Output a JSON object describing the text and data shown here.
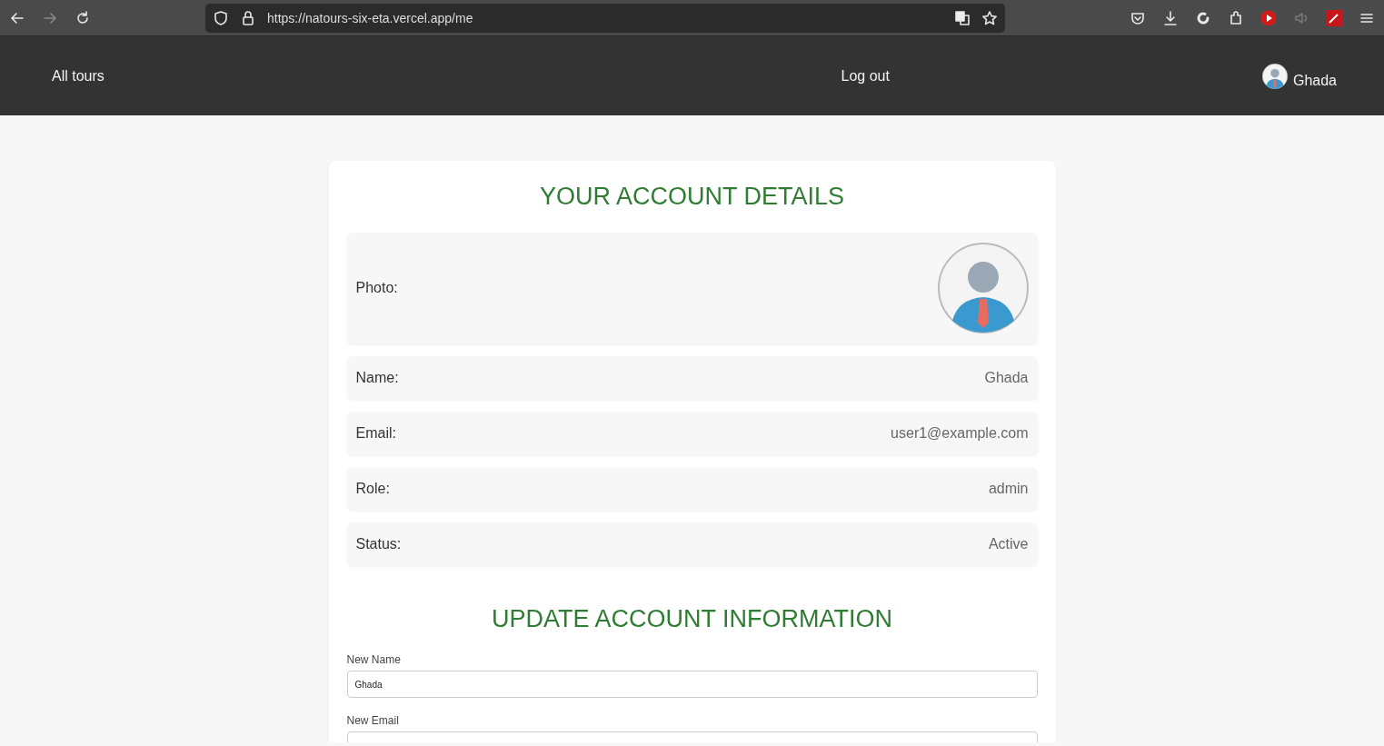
{
  "browser": {
    "url": "https://natours-six-eta.vercel.app/me",
    "forward_disabled": true
  },
  "nav": {
    "links": [
      "All tours",
      "Log out"
    ],
    "user": "Ghada"
  },
  "account": {
    "title": "YOUR ACCOUNT DETAILS",
    "details": [
      {
        "kind": "photo",
        "label": "Photo:"
      },
      {
        "kind": "text",
        "label": "Name:",
        "value": "Ghada"
      },
      {
        "kind": "text",
        "label": "Email:",
        "value": "user1@example.com"
      },
      {
        "kind": "text",
        "label": "Role:",
        "value": "admin"
      },
      {
        "kind": "text",
        "label": "Status:",
        "value": "Active"
      }
    ]
  },
  "update": {
    "title": "UPDATE ACCOUNT INFORMATION",
    "fields": [
      {
        "label": "New Name",
        "value": "Ghada"
      },
      {
        "label": "New Email"
      }
    ]
  }
}
